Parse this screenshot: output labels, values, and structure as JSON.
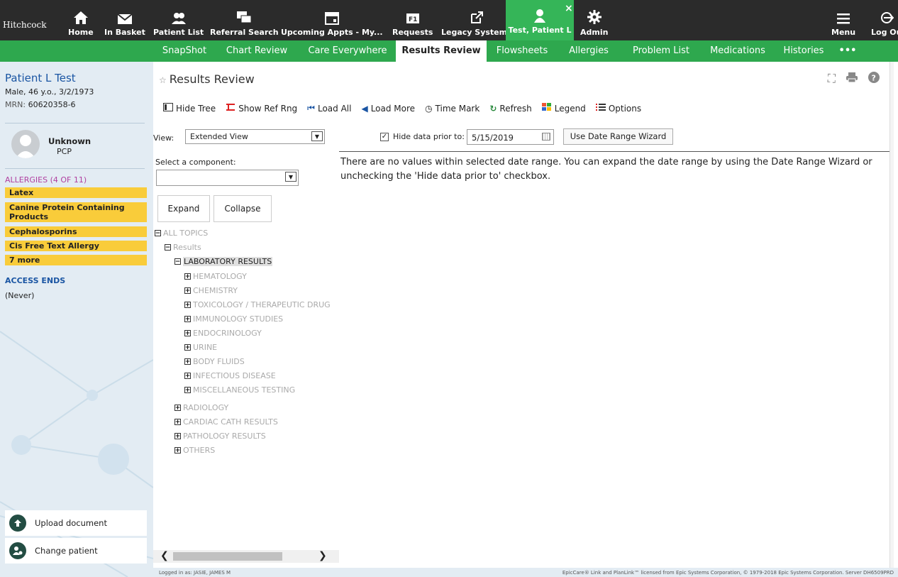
{
  "topbar": {
    "logo": "Hitchcock",
    "items": [
      "Home",
      "In Basket",
      "Patient List",
      "Referral Search",
      "Upcoming Appts - My...",
      "Requests",
      "Legacy Systems",
      "Test, Patient L",
      "Admin",
      "Menu",
      "Log Ou"
    ],
    "close_glyph": "×"
  },
  "tabs": [
    "SnapShot",
    "Chart Review",
    "Care Everywhere",
    "Results Review",
    "Flowsheets",
    "Allergies",
    "Problem List",
    "Medications",
    "Histories",
    "•••"
  ],
  "active_tab": "Results Review",
  "patient": {
    "name": "Patient L Test",
    "demographics": "Male, 46 y.o., 3/2/1973",
    "mrn_label": "MRN:",
    "mrn": "60620358-6",
    "pcp_name": "Unknown",
    "pcp_role": "PCP"
  },
  "allergies": {
    "heading": "ALLERGIES (4 OF 11)",
    "items": [
      "Latex",
      "Canine Protein Containing Products",
      "Cephalosporins",
      "Cis Free Text Allergy",
      "7 more"
    ]
  },
  "access": {
    "heading": "ACCESS ENDS",
    "value": "(Never)"
  },
  "sidebar_buttons": {
    "upload": "Upload document",
    "change": "Change patient"
  },
  "results": {
    "title": "Results Review",
    "toolbar": [
      "Hide Tree",
      "Show Ref Rng",
      "Load All",
      "Load More",
      "Time Mark",
      "Refresh",
      "Legend",
      "Options"
    ],
    "view_label": "View:",
    "view_value": "Extended View",
    "hide_label": "Hide data prior to:",
    "hide_checked": true,
    "hide_date": "5/15/2019",
    "wizard_button": "Use Date Range Wizard",
    "select_component_label": "Select a component:",
    "expand": "Expand",
    "collapse": "Collapse",
    "message": "There are no values within selected date range. You can expand the date range by using the Date Range Wizard or unchecking the 'Hide data prior to' checkbox.",
    "tree": [
      "ALL TOPICS",
      "Results",
      "LABORATORY RESULTS",
      "HEMATOLOGY",
      "CHEMISTRY",
      "TOXICOLOGY / THERAPEUTIC DRUG",
      "IMMUNOLOGY STUDIES",
      "ENDOCRINOLOGY",
      "URINE",
      "BODY FLUIDS",
      "INFECTIOUS DISEASE",
      "MISCELLANEOUS TESTING",
      "RADIOLOGY",
      "CARDIAC CATH RESULTS",
      "PATHOLOGY RESULTS",
      "OTHERS"
    ]
  },
  "footer": {
    "logged_in": "Logged in as: JASIE, JAMES M",
    "copyright": "EpicCare® Link and PlanLink™ licensed from Epic Systems Corporation, © 1979-2018 Epic Systems Corporation. Server DH6509PRD"
  },
  "colors": {
    "topbar": "#2b2b2b",
    "green": "#2ea84e",
    "allergy": "#f9cc3a",
    "sidebar": "#e3ecf3",
    "link_blue": "#1a55a3"
  }
}
